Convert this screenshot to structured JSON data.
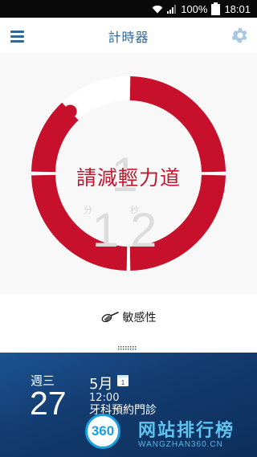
{
  "status_bar": {
    "battery": "100%",
    "time": "18:01"
  },
  "app_bar": {
    "title": "計時器",
    "menu_icon": "hamburger-menu-icon",
    "settings_icon": "gear-icon"
  },
  "timer": {
    "digits": "1 12",
    "unit_min": "分",
    "unit_sec": "秒",
    "instruction": "請減輕力道",
    "progress_fraction": 0.88,
    "accent_color": "#c6102c"
  },
  "mode": {
    "label": "敏感性",
    "icon": "toothbrush-icon"
  },
  "calendar": {
    "weekday": "週三",
    "day": "27",
    "month": "5月",
    "calendar_icon_label": "1",
    "event_time": "12:00",
    "event_title": "牙科預約門診"
  },
  "watermark": {
    "badge": "360",
    "text": "网站排行榜",
    "sub": "WANGZHAN360.CN"
  }
}
